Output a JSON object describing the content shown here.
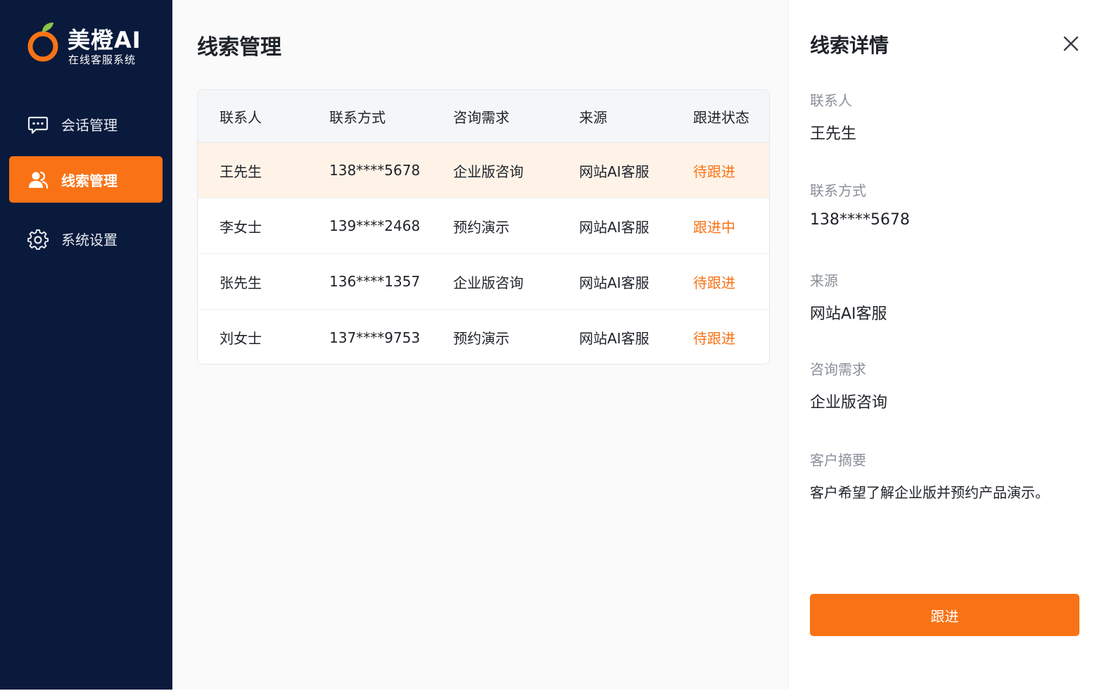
{
  "brand": {
    "name": "美橙AI",
    "subtitle": "在线客服系统",
    "accent_color": "#f97316",
    "sidebar_color": "#0a1a3c"
  },
  "sidebar": {
    "items": [
      {
        "label": "会话管理",
        "icon": "chat-bubble-icon",
        "active": false
      },
      {
        "label": "线索管理",
        "icon": "users-icon",
        "active": true
      },
      {
        "label": "系统设置",
        "icon": "gear-icon",
        "active": false
      }
    ]
  },
  "main": {
    "title": "线索管理",
    "table": {
      "headers": [
        "联系人",
        "联系方式",
        "咨询需求",
        "来源",
        "跟进状态"
      ],
      "rows": [
        {
          "name": "王先生",
          "contact": "138****5678",
          "need": "企业版咨询",
          "source": "网站AI客服",
          "status": "待跟进",
          "selected": true
        },
        {
          "name": "李女士",
          "contact": "139****2468",
          "need": "预约演示",
          "source": "网站AI客服",
          "status": "跟进中"
        },
        {
          "name": "张先生",
          "contact": "136****1357",
          "need": "企业版咨询",
          "source": "网站AI客服",
          "status": "待跟进"
        },
        {
          "name": "刘女士",
          "contact": "137****9753",
          "need": "预约演示",
          "source": "网站AI客服",
          "status": "待跟进"
        }
      ]
    }
  },
  "detail": {
    "title": "线索详情",
    "fields": [
      {
        "label": "联系人",
        "value": "王先生"
      },
      {
        "label": "联系方式",
        "value": "138****5678"
      },
      {
        "label": "来源",
        "value": "网站AI客服"
      },
      {
        "label": "咨询需求",
        "value": "企业版咨询"
      },
      {
        "label": "客户摘要",
        "value": "客户希望了解企业版并预约产品演示。"
      }
    ],
    "button_label": "跟进"
  }
}
